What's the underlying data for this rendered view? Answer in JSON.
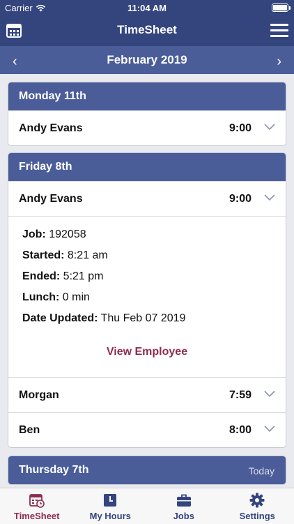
{
  "status_bar": {
    "carrier": "Carrier",
    "time": "11:04 AM"
  },
  "nav": {
    "title": "TimeSheet",
    "left_icon": "calendar-icon",
    "right_icon": "hamburger-menu-icon"
  },
  "month_bar": {
    "label": "February 2019",
    "prev": "‹",
    "next": "›"
  },
  "days": [
    {
      "title": "Monday 11th",
      "badge": "",
      "entries": [
        {
          "name": "Andy Evans",
          "hours": "9:00"
        }
      ]
    },
    {
      "title": "Friday 8th",
      "badge": "",
      "entries": [
        {
          "name": "Andy Evans",
          "hours": "9:00",
          "details": {
            "job_label": "Job:",
            "job": "192058",
            "started_label": "Started:",
            "started": "8:21 am",
            "ended_label": "Ended:",
            "ended": "5:21 pm",
            "lunch_label": "Lunch:",
            "lunch": "0 min",
            "updated_label": "Date Updated:",
            "updated": "Thu Feb 07 2019",
            "action": "View Employee"
          }
        },
        {
          "name": "Morgan",
          "hours": "7:59"
        },
        {
          "name": "Ben",
          "hours": "8:00"
        }
      ]
    },
    {
      "title": "Thursday 7th",
      "badge": "Today",
      "entries": []
    }
  ],
  "tabs": [
    {
      "label": "TimeSheet",
      "icon": "timesheet-calendar-icon",
      "active": true
    },
    {
      "label": "My Hours",
      "icon": "clock-icon",
      "active": false
    },
    {
      "label": "Jobs",
      "icon": "briefcase-icon",
      "active": false
    },
    {
      "label": "Settings",
      "icon": "gear-icon",
      "active": false
    }
  ],
  "colors": {
    "primary": "#34457e",
    "header": "#4b5d99",
    "accent": "#8e2b4e"
  }
}
